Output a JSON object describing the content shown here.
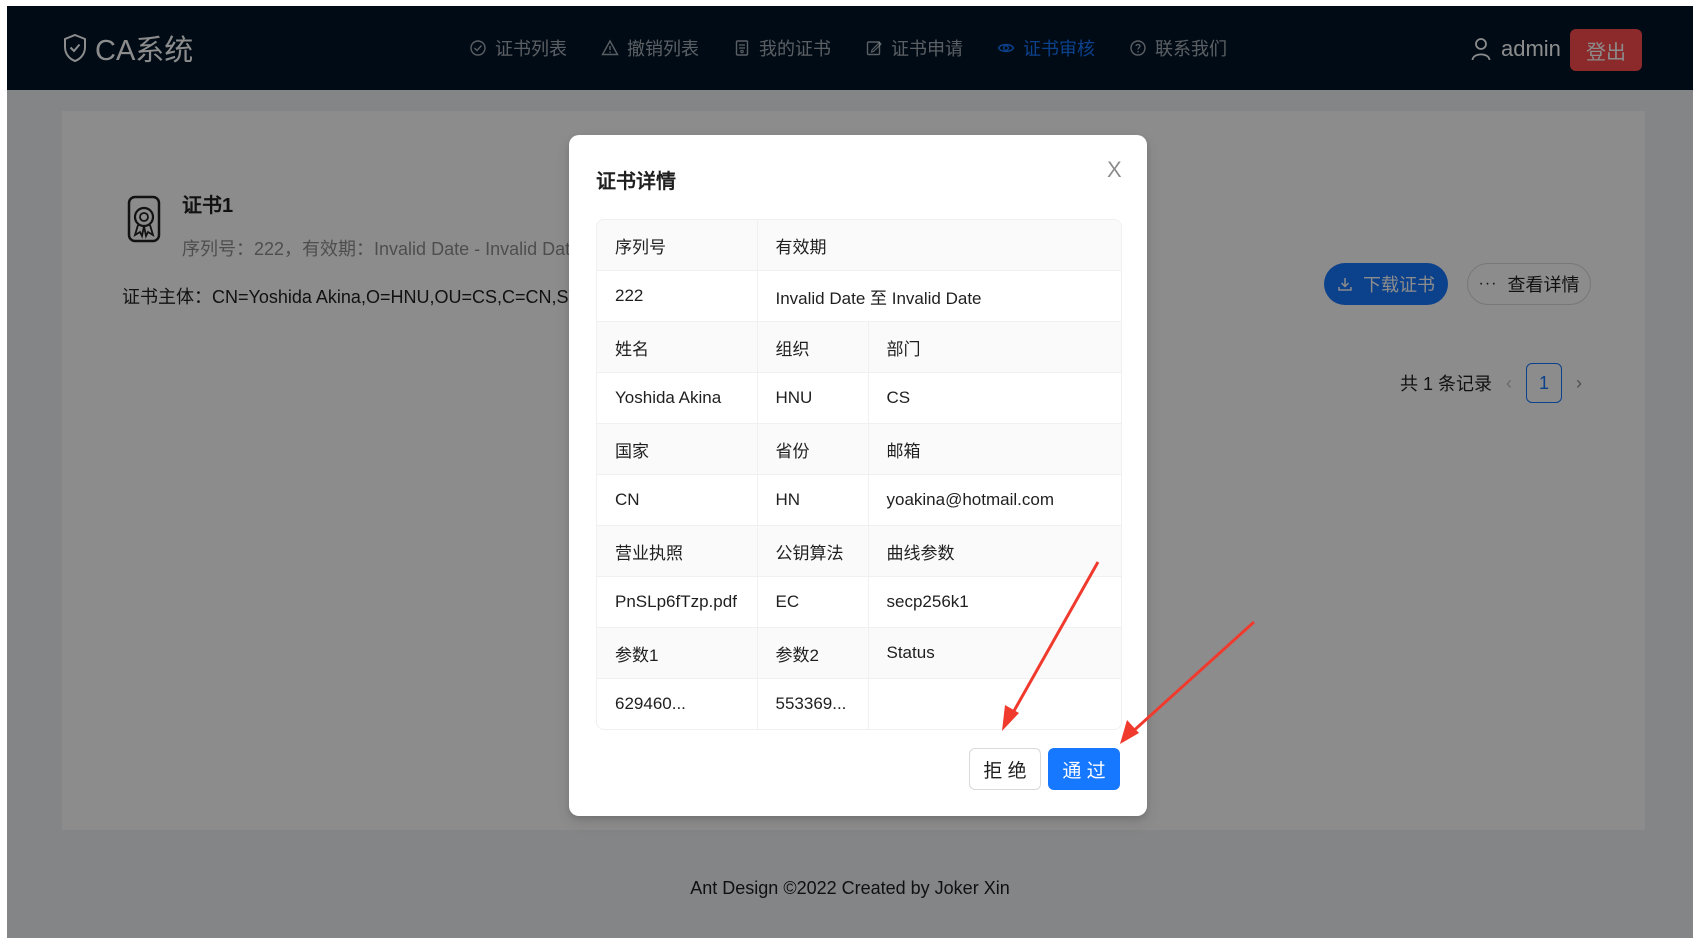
{
  "header": {
    "logo_text": "CA系统",
    "nav": [
      {
        "label": "证书列表",
        "icon": "check-circle-icon"
      },
      {
        "label": "撤销列表",
        "icon": "warning-icon"
      },
      {
        "label": "我的证书",
        "icon": "file-icon"
      },
      {
        "label": "证书申请",
        "icon": "edit-icon"
      },
      {
        "label": "证书审核",
        "icon": "eye-icon",
        "active": true
      },
      {
        "label": "联系我们",
        "icon": "question-circle-icon"
      }
    ],
    "username": "admin",
    "logout_label": "登出"
  },
  "list": {
    "item": {
      "title": "证书1",
      "description": "序列号：222，有效期：Invalid Date - Invalid Date",
      "subject": "证书主体：CN=Yoshida Akina,O=HNU,OU=CS,C=CN,ST=HN",
      "download_label": "下载证书",
      "detail_label": "查看详情"
    },
    "pagination": {
      "total_text": "共 1 条记录",
      "current": "1"
    }
  },
  "footer": {
    "text": "Ant Design ©2022 Created by Joker Xin"
  },
  "modal": {
    "title": "证书详情",
    "close": "X",
    "rows": [
      {
        "serial_label": "序列号",
        "validity_label": "有效期"
      },
      {
        "serial": "222",
        "validity": "Invalid Date 至 Invalid Date"
      },
      {
        "name_label": "姓名",
        "org_label": "组织",
        "dept_label": "部门"
      },
      {
        "name": "Yoshida Akina",
        "org": "HNU",
        "dept": "CS"
      },
      {
        "country_label": "国家",
        "province_label": "省份",
        "email_label": "邮箱"
      },
      {
        "country": "CN",
        "province": "HN",
        "email": "yoakina@hotmail.com"
      },
      {
        "license_label": "营业执照",
        "algo_label": "公钥算法",
        "curve_label": "曲线参数"
      },
      {
        "license": "PnSLp6fTzp.pdf",
        "algo": "EC",
        "curve": "secp256k1"
      },
      {
        "param1_label": "参数1",
        "param2_label": "参数2",
        "status_label": "Status"
      },
      {
        "param1": "629460...",
        "param2": "553369...",
        "status": ""
      }
    ],
    "reject_label": "拒 绝",
    "approve_label": "通 过"
  },
  "colors": {
    "primary": "#1677ff",
    "danger": "#ff4d4f",
    "header_bg": "#001529",
    "arrow": "#f03a2e"
  }
}
